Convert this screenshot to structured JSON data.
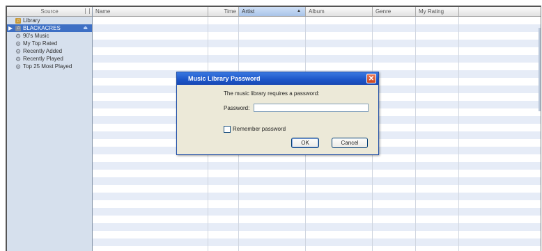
{
  "sidebar": {
    "header": "Source",
    "items": [
      {
        "label": "Library",
        "icon": "library-icon"
      },
      {
        "label": "BLACKACRES",
        "icon": "shared-library-icon",
        "selected": true
      },
      {
        "label": "90's Music",
        "icon": "smart-playlist-gear-icon"
      },
      {
        "label": "My Top Rated",
        "icon": "smart-playlist-gear-icon"
      },
      {
        "label": "Recently Added",
        "icon": "smart-playlist-gear-icon"
      },
      {
        "label": "Recently Played",
        "icon": "smart-playlist-gear-icon"
      },
      {
        "label": "Top 25 Most Played",
        "icon": "smart-playlist-gear-icon"
      }
    ]
  },
  "columns": [
    "Name",
    "Time",
    "Artist",
    "Album",
    "Genre",
    "My Rating"
  ],
  "sorted_column": "Artist",
  "dialog": {
    "title": "Music Library Password",
    "message": "The music library requires a password:",
    "password_label": "Password:",
    "password_value": "",
    "remember_label": "Remember password",
    "remember_checked": false,
    "ok_label": "OK",
    "cancel_label": "Cancel"
  }
}
